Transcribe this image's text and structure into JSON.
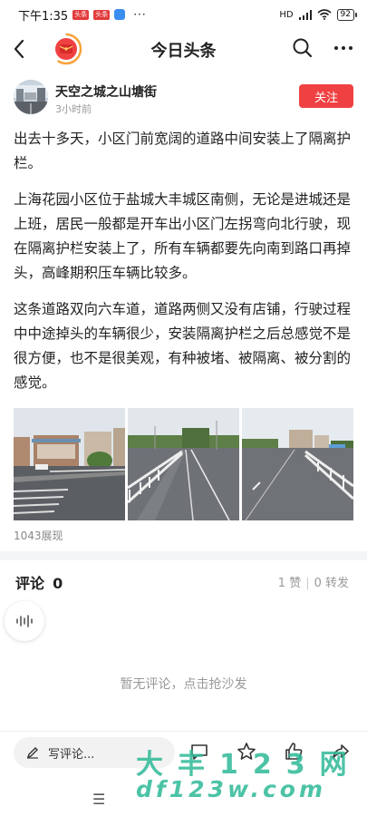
{
  "status_bar": {
    "time": "下午1:35",
    "badge_1": "头条",
    "badge_2": "头条",
    "dots": "···",
    "net": "HD",
    "battery": "92"
  },
  "nav": {
    "title": "今日头条",
    "back_icon": "back-arrow-icon",
    "search_icon": "search-icon",
    "more_icon": "more-icon"
  },
  "author": {
    "name": "天空之城之山塘街",
    "time": "3小时前",
    "follow_label": "关注"
  },
  "article": {
    "paragraphs": [
      "出去十多天，小区门前宽阔的道路中间安装上了隔离护栏。",
      "上海花园小区位于盐城大丰城区南侧，无论是进城还是上班，居民一般都是开车出小区门左拐弯向北行驶，现在隔离护栏安装上了，所有车辆都要先向南到路口再掉头，高峰期积压车辆比较多。",
      "这条道路双向六车道，道路两侧又没有店铺，行驶过程中中途掉头的车辆很少，安装隔离护栏之后总感觉不是很方便，也不是很美观，有种被堵、被隔离、被分割的感觉。"
    ],
    "views": "1043展现"
  },
  "comments": {
    "title": "评论",
    "count": "0",
    "likes": "1 赞",
    "reposts": "0 转发",
    "empty_text": "暂无评论，点击抢沙发"
  },
  "bottom_bar": {
    "input_placeholder": "写评论...",
    "icons": [
      "comment-icon",
      "star-icon",
      "thumbs-up-icon",
      "share-icon"
    ]
  },
  "watermark": {
    "top": "大丰123网",
    "bottom": "df123w.com"
  },
  "colors": {
    "accent": "#f04142",
    "watermark": "#2eb897"
  }
}
